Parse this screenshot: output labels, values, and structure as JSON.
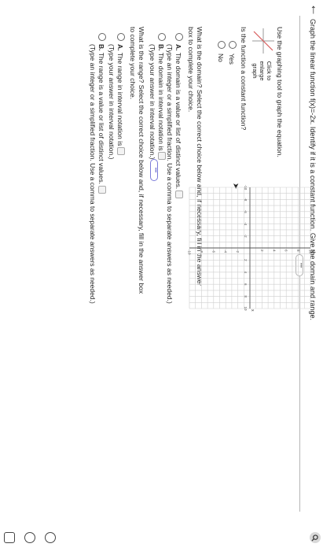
{
  "question": "Graph the linear function f(x)=-2x. Identify if it is a constant function. Give the domain and range.",
  "instruction": "Use the graphing tool to graph the equation.",
  "enlarge": {
    "l1": "Click to",
    "l2": "enlarge",
    "l3": "graph"
  },
  "q_constant": "Is the function a constant function?",
  "options_constant": [
    "Yes",
    "No"
  ],
  "domain_prompt": "What is the domain? Select the correct choice below and, if necessary, fill in the answer box to complete your choice.",
  "domain_a_letter": "A.",
  "domain_a_text": "The domain is a value or list of distinct values.",
  "domain_a_hint": "(Type an integer or a simplified fraction. Use a comma to separate answers as needed.)",
  "domain_b_letter": "B.",
  "domain_b_text": "The domain in interval notation is",
  "domain_b_hint": "(Type your answer in interval notation.)",
  "range_prompt": "What is the range? Select the correct choice below and, if necessary, fill in the answer box to complete your choice.",
  "range_a_letter": "A.",
  "range_a_text": "The range in interval notation is",
  "range_a_hint": "(Type your answer in interval notation.)",
  "range_b_letter": "B.",
  "range_b_text": "The range is a value or list of distinct values.",
  "range_b_hint": "(Type an integer or a simplified fraction. Use a comma to separate answers as needed.)",
  "graph": {
    "x_label": "x",
    "y_label": "Ay",
    "x_ticks": [
      "-10",
      "-8",
      "-6",
      "-4",
      "-2",
      "2",
      "4",
      "6",
      "8",
      "10"
    ],
    "y_ticks": [
      "10",
      "8",
      "6",
      "4",
      "2",
      "-2",
      "-4",
      "-6",
      "-8",
      "-10"
    ]
  },
  "colors": {
    "accent": "#4a4ac0",
    "grid": "#cfcfcf"
  }
}
